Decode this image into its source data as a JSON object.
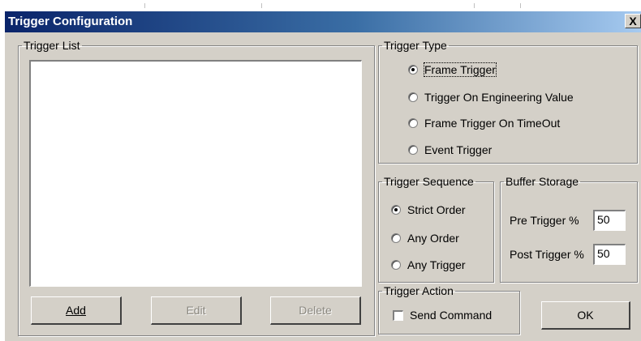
{
  "window": {
    "title": "Trigger Configuration",
    "close_label": "X"
  },
  "trigger_list": {
    "legend": "Trigger List",
    "buttons": {
      "add": "Add",
      "edit": "Edit",
      "delete": "Delete"
    }
  },
  "trigger_type": {
    "legend": "Trigger Type",
    "options": [
      {
        "label": "Frame Trigger",
        "selected": true
      },
      {
        "label": "Trigger On Engineering Value",
        "selected": false
      },
      {
        "label": "Frame Trigger On TimeOut",
        "selected": false
      },
      {
        "label": "Event Trigger",
        "selected": false
      }
    ]
  },
  "trigger_sequence": {
    "legend": "Trigger Sequence",
    "options": [
      {
        "label": "Strict Order",
        "selected": true
      },
      {
        "label": "Any Order",
        "selected": false
      },
      {
        "label": "Any Trigger",
        "selected": false
      }
    ]
  },
  "buffer_storage": {
    "legend": "Buffer Storage",
    "pre_label": "Pre Trigger %",
    "pre_value": "50",
    "post_label": "Post Trigger %",
    "post_value": "50"
  },
  "trigger_action": {
    "legend": "Trigger Action",
    "send_command_label": "Send Command",
    "send_command_checked": false
  },
  "ok_button": "OK"
}
